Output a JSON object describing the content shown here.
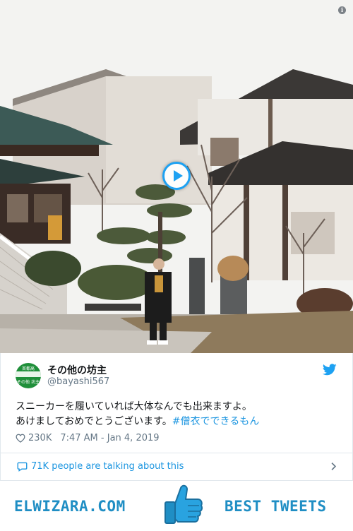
{
  "video": {
    "info_icon": "info-icon",
    "info_glyph": "i",
    "play_icon": "play-icon"
  },
  "tweet": {
    "display_name": "その他の坊主",
    "handle": "@bayashi567",
    "avatar_icon": "avatar",
    "avatar_top_text": "首都高",
    "avatar_bottom_text": "その他 坊主",
    "text_line1": "スニーカーを履いていれば大体なんでも出来ますよ。",
    "text_line2": "あけましておめでとうございます。",
    "hashtag": "#僧衣でできるもん",
    "likes": "230K",
    "timestamp": "7:47 AM - Jan 4, 2019",
    "talking": "71K people are talking about this",
    "brand_color": "#1da1f2",
    "link_color": "#1b95e0"
  },
  "banner": {
    "site": "ELWIZARA.COM",
    "tagline": "BEST TWEETS",
    "icon": "thumbs-up-icon",
    "color": "#1f8ec4"
  }
}
